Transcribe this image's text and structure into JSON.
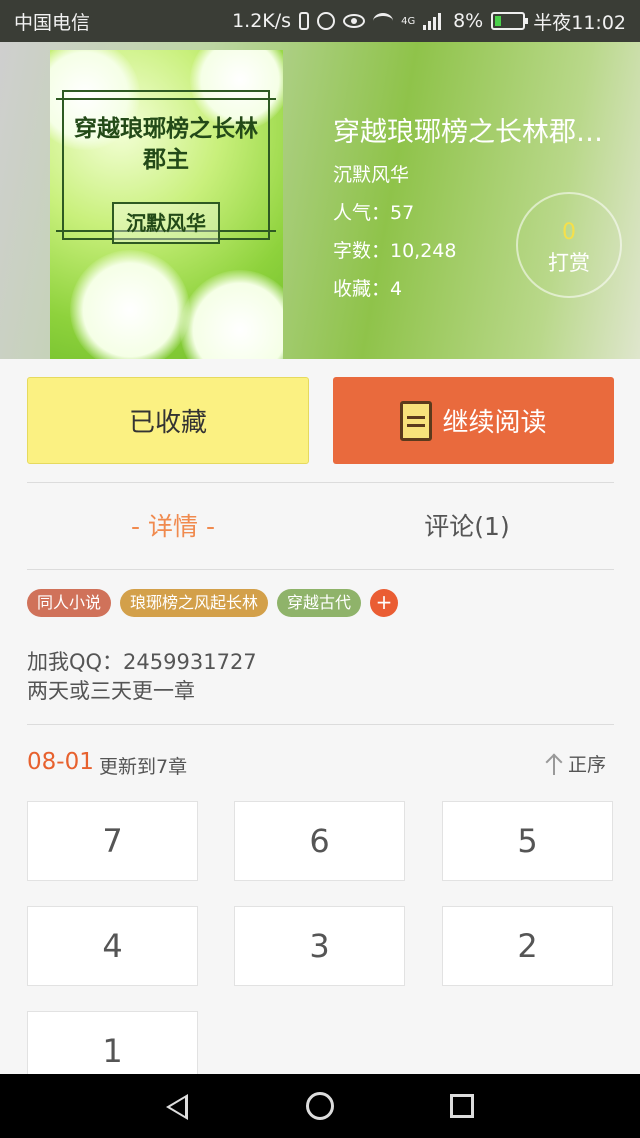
{
  "status_bar": {
    "carrier": "中国电信",
    "speed": "1.2K/s",
    "network": "4G",
    "battery": "8%",
    "time": "半夜11:02"
  },
  "book": {
    "cover_title": "穿越琅琊榜之长林郡主",
    "cover_author": "沉默风华",
    "title": "穿越琅琊榜之长林郡…",
    "author": "沉默风华",
    "popularity": "人气：57",
    "word_count": "字数：10,248",
    "favorites": "收藏：4"
  },
  "tip": {
    "count": "0",
    "label": "打赏"
  },
  "actions": {
    "favorited_label": "已收藏",
    "continue_label": "继续阅读"
  },
  "tabs": {
    "detail": "- 详情 -",
    "comments": "评论(1)"
  },
  "tags": [
    {
      "label": "同人小说",
      "color": "#d0725a"
    },
    {
      "label": "琅琊榜之风起长林",
      "color": "#d3a04a"
    },
    {
      "label": "穿越古代",
      "color": "#8fb36a"
    }
  ],
  "tag_add": "+",
  "description": "加我QQ：2459931727\n两天或三天更一章",
  "update": {
    "date": "08-01",
    "text": "更新到7章",
    "sort_label": "正序"
  },
  "chapters": [
    "7",
    "6",
    "5",
    "4",
    "3",
    "2",
    "1"
  ],
  "colors": {
    "accent": "#e96a3d",
    "favorite": "#fbf182",
    "tab_active": "#f08a4e"
  },
  "icons": [
    "back-icon",
    "share-icon",
    "book-icon",
    "sort-up-icon",
    "nav-back-icon",
    "nav-home-icon",
    "nav-recent-icon"
  ]
}
